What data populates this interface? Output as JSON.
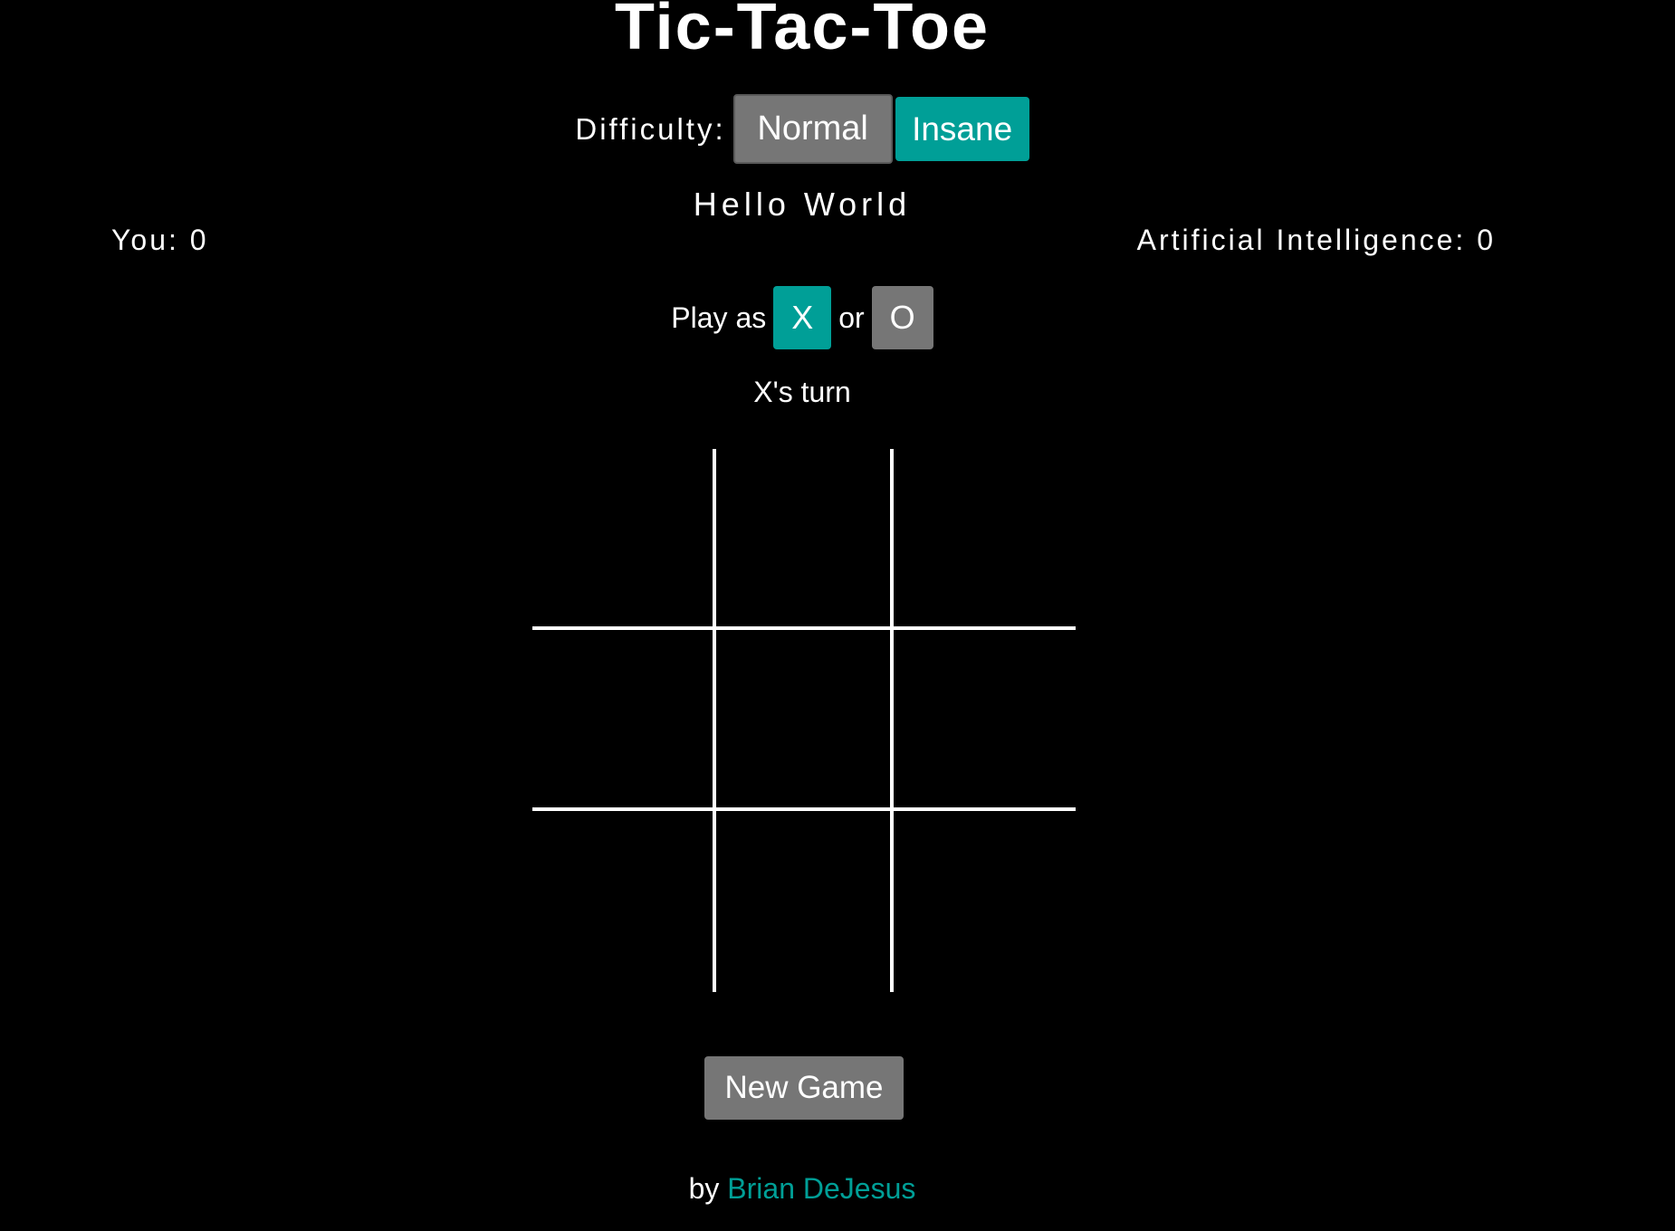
{
  "title": "Tic-Tac-Toe",
  "difficulty": {
    "label": "Difficulty:",
    "options": [
      "Normal",
      "Insane"
    ],
    "selected": "Insane"
  },
  "subtitle": "Hello World",
  "scores": {
    "you_label": "You: 0",
    "ai_label": "Artificial Intelligence: 0",
    "you": 0,
    "ai": 0
  },
  "play_as": {
    "label": "Play as",
    "or": "or",
    "x": "X",
    "o": "O",
    "selected": "X"
  },
  "turn": "X's turn",
  "board": [
    "",
    "",
    "",
    "",
    "",
    "",
    "",
    "",
    ""
  ],
  "new_game": "New Game",
  "footer": {
    "by": "by",
    "author": "Brian DeJesus"
  },
  "colors": {
    "background": "#000000",
    "accent": "#009f97",
    "button_gray": "#767676",
    "text": "#ffffff"
  }
}
